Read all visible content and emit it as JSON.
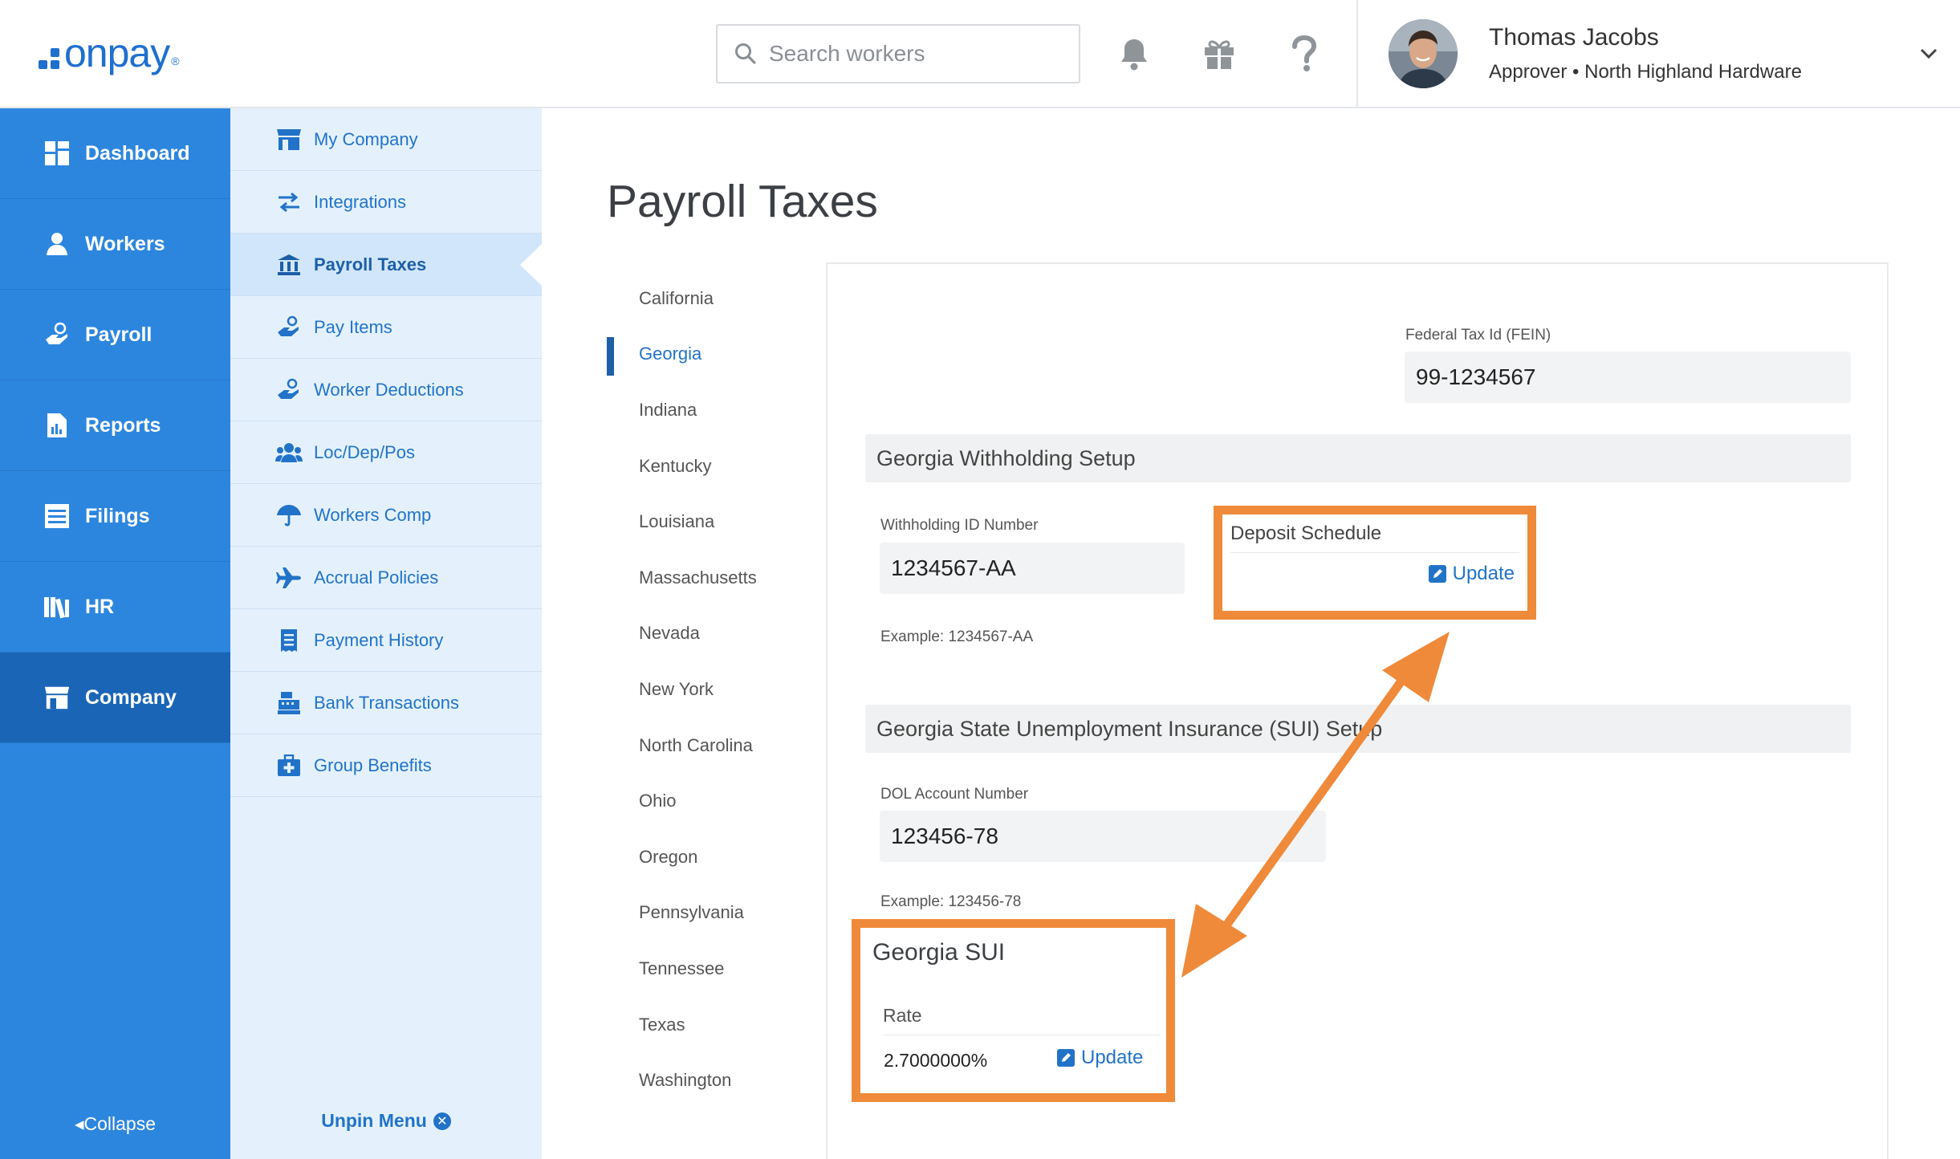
{
  "brand": {
    "name": "onpay",
    "reg": "®"
  },
  "search": {
    "placeholder": "Search workers"
  },
  "user": {
    "name": "Thomas Jacobs",
    "role": "Approver • North Highland Hardware"
  },
  "leftnav": {
    "items": [
      {
        "label": "Dashboard",
        "icon": "dashboard-icon"
      },
      {
        "label": "Workers",
        "icon": "workers-icon"
      },
      {
        "label": "Payroll",
        "icon": "payroll-icon"
      },
      {
        "label": "Reports",
        "icon": "reports-icon"
      },
      {
        "label": "Filings",
        "icon": "filings-icon"
      },
      {
        "label": "HR",
        "icon": "hr-icon"
      },
      {
        "label": "Company",
        "icon": "company-icon",
        "active": true
      }
    ],
    "collapse_label": "Collapse"
  },
  "subnav": {
    "items": [
      {
        "label": "My Company",
        "icon": "store-icon"
      },
      {
        "label": "Integrations",
        "icon": "arrows-icon"
      },
      {
        "label": "Payroll Taxes",
        "icon": "bank-icon",
        "active": true
      },
      {
        "label": "Pay Items",
        "icon": "hand-coin-icon"
      },
      {
        "label": "Worker Deductions",
        "icon": "hand-coin-icon"
      },
      {
        "label": "Loc/Dep/Pos",
        "icon": "users-icon"
      },
      {
        "label": "Workers Comp",
        "icon": "umbrella-icon"
      },
      {
        "label": "Accrual Policies",
        "icon": "plane-icon"
      },
      {
        "label": "Payment History",
        "icon": "receipt-icon"
      },
      {
        "label": "Bank Transactions",
        "icon": "register-icon"
      },
      {
        "label": "Group Benefits",
        "icon": "medkit-icon"
      }
    ],
    "unpin_label": "Unpin Menu"
  },
  "main": {
    "title": "Payroll Taxes",
    "states": [
      "California",
      "Georgia",
      "Indiana",
      "Kentucky",
      "Louisiana",
      "Massachusetts",
      "Nevada",
      "New York",
      "North Carolina",
      "Ohio",
      "Oregon",
      "Pennsylvania",
      "Tennessee",
      "Texas",
      "Washington"
    ],
    "active_state": "Georgia",
    "fein": {
      "label": "Federal Tax Id (FEIN)",
      "value": "99-1234567"
    },
    "withholding": {
      "header": "Georgia Withholding Setup",
      "id_label": "Withholding ID Number",
      "id_value": "1234567-AA",
      "example": "Example: 1234567-AA",
      "deposit_label": "Deposit Schedule",
      "update_label": "Update"
    },
    "sui": {
      "header": "Georgia State Unemployment Insurance (SUI) Setup",
      "dol_label": "DOL Account Number",
      "dol_value": "123456-78",
      "example": "Example: 123456-78",
      "box_title": "Georgia SUI",
      "rate_label": "Rate",
      "rate_value": "2.7000000%",
      "update_label": "Update"
    }
  },
  "colors": {
    "brand_blue": "#1f6fcf",
    "nav_blue": "#2d86de",
    "nav_active": "#1a65b6",
    "subnav_bg": "#e4f1fd",
    "highlight_orange": "#ef8a3a"
  }
}
